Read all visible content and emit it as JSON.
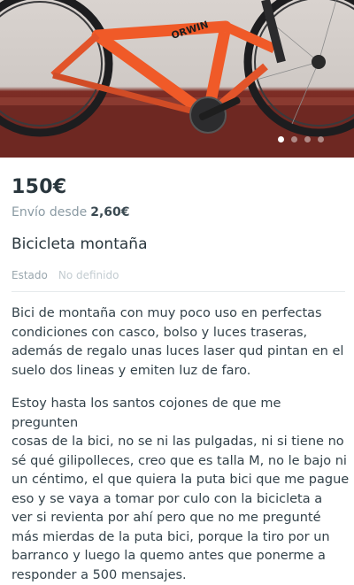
{
  "listing": {
    "photo_alt": "bicycle-photo",
    "bike_brand_text": "ORWIN",
    "gallery": {
      "count": 4,
      "active_index": 0
    },
    "price": "150€",
    "shipping_label": "Envío desde",
    "shipping_amount": "2,60€",
    "title": "Bicicleta montaña",
    "state_label": "Estado",
    "state_value": "No definido",
    "description_1": "Bici de montaña con muy poco uso en perfectas\ncondiciones con casco, bolso y luces traseras,\nademás de regalo unas luces laser qud pintan en el\nsuelo dos lineas y emiten luz de faro.",
    "description_2": "Estoy hasta los santos cojones de que me pregunten\ncosas de la bici, no se ni las pulgadas, ni si tiene no\nsé qué gilipolleces, creo que es talla M, no le bajo ni\nun céntimo, el que quiera la puta bici que me pague\neso y se vaya a tomar por culo con la bicicleta a\nver si revienta por ahí pero que no me pregunté\nmás mierdas de la puta bici, porque la tiro por un\nbarranco y luego la quemo antes que ponerme a\nresponder a 500 mensajes."
  },
  "colors": {
    "text": "#29363d",
    "muted": "#8a9aa3",
    "bike_orange": "#f05a28"
  }
}
